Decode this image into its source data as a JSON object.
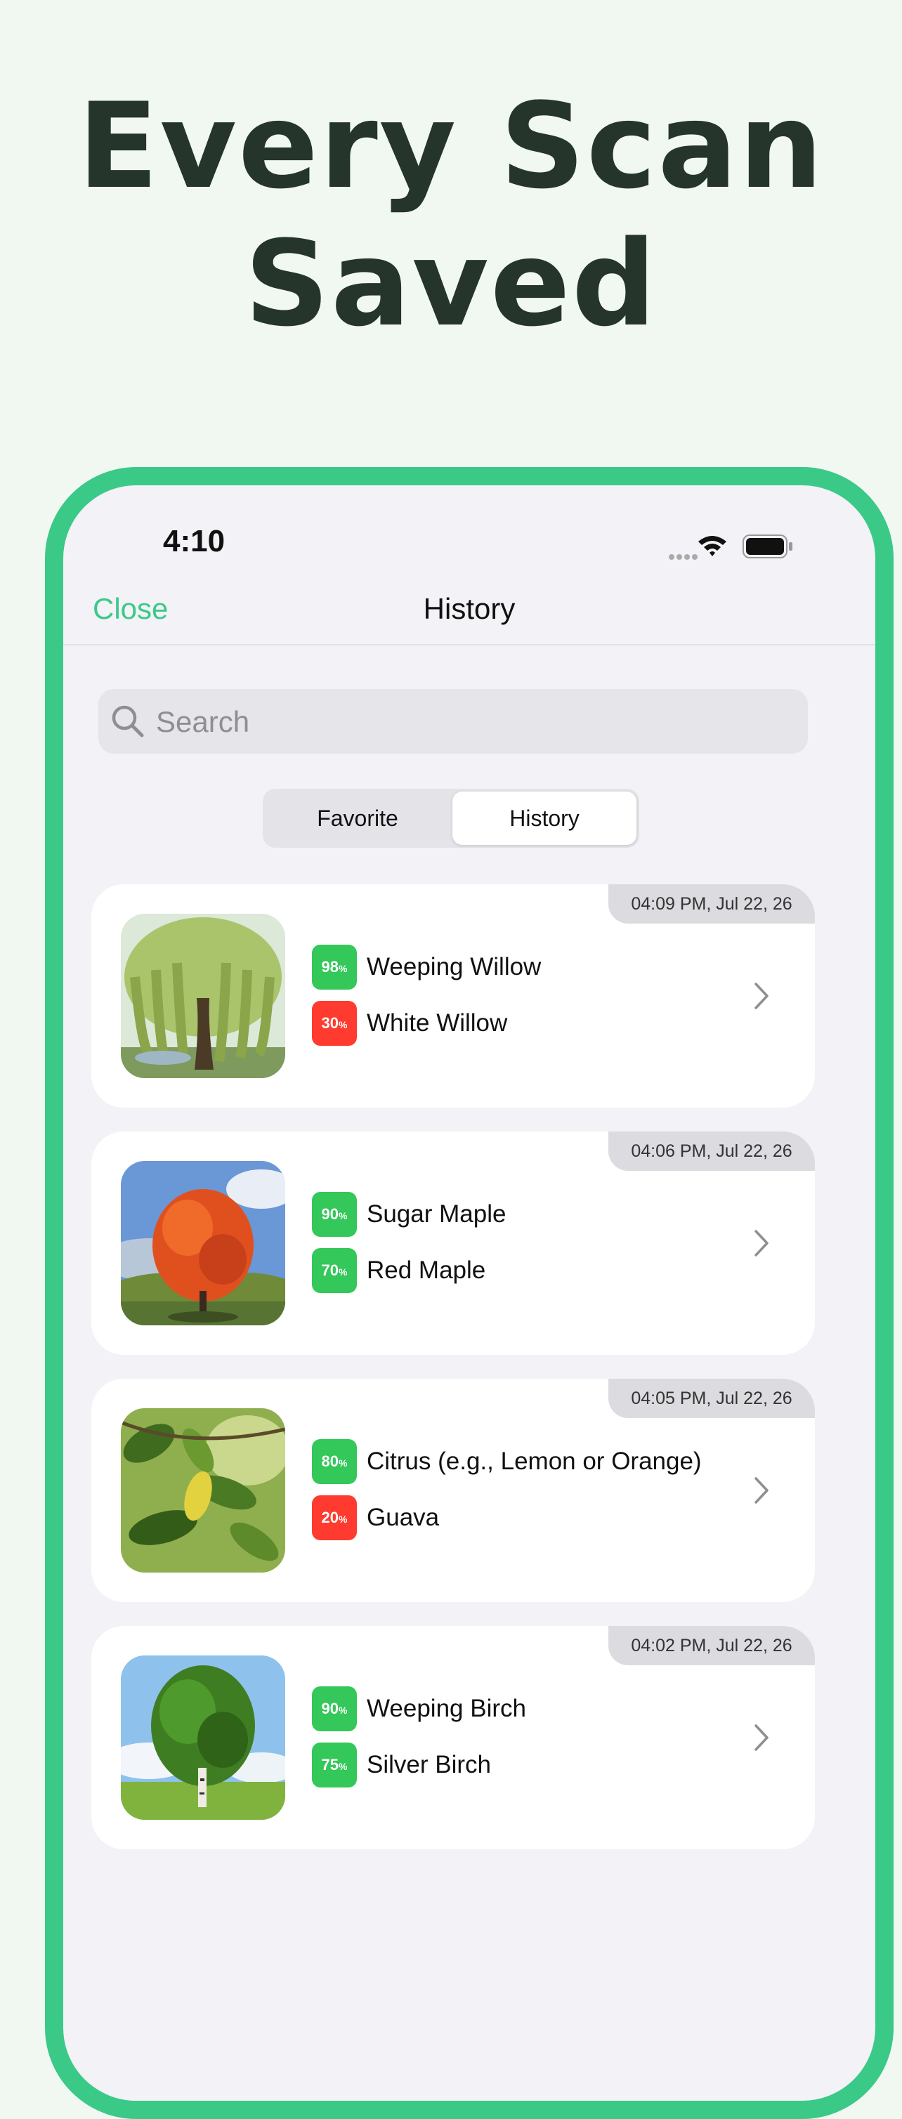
{
  "headline": {
    "line1": "Every Scan",
    "line2": "Saved"
  },
  "status_bar": {
    "time": "4:10"
  },
  "nav": {
    "close_label": "Close",
    "title": "History"
  },
  "search": {
    "placeholder": "Search",
    "value": ""
  },
  "segments": {
    "options": [
      "Favorite",
      "History"
    ],
    "selected": "History"
  },
  "colors": {
    "accent": "#3bc987",
    "high": "#34c759",
    "low": "#ff3b30",
    "headline": "#26352b"
  },
  "history": [
    {
      "time": "04:09 PM, Jul 22, 26",
      "image": "weeping-willow-photo",
      "matches": [
        {
          "pct": "98",
          "name": "Weeping Willow",
          "color": "#34c759"
        },
        {
          "pct": "30",
          "name": "White Willow",
          "color": "#ff3b30"
        }
      ]
    },
    {
      "time": "04:06 PM, Jul 22, 26",
      "image": "sugar-maple-photo",
      "matches": [
        {
          "pct": "90",
          "name": "Sugar Maple",
          "color": "#34c759"
        },
        {
          "pct": "70",
          "name": "Red Maple",
          "color": "#34c759"
        }
      ]
    },
    {
      "time": "04:05 PM, Jul 22, 26",
      "image": "citrus-leaves-photo",
      "matches": [
        {
          "pct": "80",
          "name": "Citrus (e.g., Lemon or Orange)",
          "color": "#34c759"
        },
        {
          "pct": "20",
          "name": "Guava",
          "color": "#ff3b30"
        }
      ]
    },
    {
      "time": "04:02 PM, Jul 22, 26",
      "image": "weeping-birch-photo",
      "matches": [
        {
          "pct": "90",
          "name": "Weeping Birch",
          "color": "#34c759"
        },
        {
          "pct": "75",
          "name": "Silver Birch",
          "color": "#34c759"
        }
      ]
    }
  ],
  "pct_unit": "%"
}
